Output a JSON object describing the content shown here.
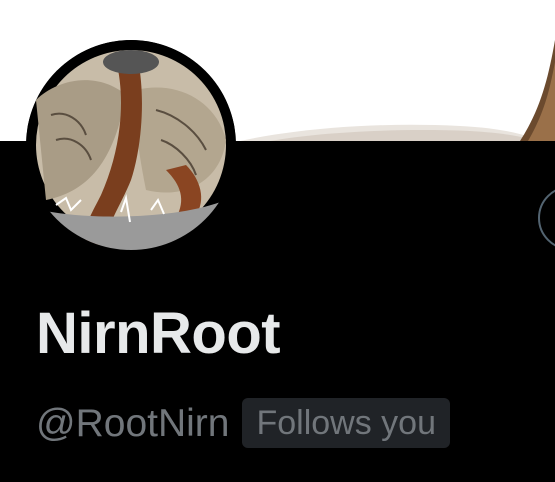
{
  "profile": {
    "display_name": "NirnRoot",
    "handle": "@RootNirn",
    "follows_you_label": "Follows you"
  },
  "icons": {
    "avatar": "profile-avatar-drawing",
    "action_button": "more-options-circle-icon"
  },
  "colors": {
    "background": "#000000",
    "banner": "#ffffff",
    "name_text": "#e7e9ea",
    "secondary_text": "#71767b",
    "badge_background": "#202327",
    "button_border": "#536471"
  }
}
